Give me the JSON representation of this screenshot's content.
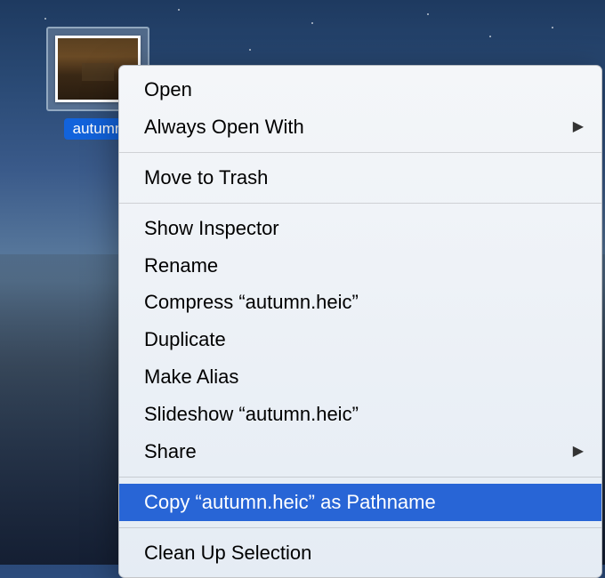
{
  "file": {
    "label": "autumn"
  },
  "menu": {
    "items": [
      {
        "label": "Open",
        "hasSubmenu": false,
        "highlighted": false
      },
      {
        "label": "Always Open With",
        "hasSubmenu": true,
        "highlighted": false
      },
      {
        "type": "separator"
      },
      {
        "label": "Move to Trash",
        "hasSubmenu": false,
        "highlighted": false
      },
      {
        "type": "separator"
      },
      {
        "label": "Show Inspector",
        "hasSubmenu": false,
        "highlighted": false
      },
      {
        "label": "Rename",
        "hasSubmenu": false,
        "highlighted": false
      },
      {
        "label": "Compress “autumn.heic”",
        "hasSubmenu": false,
        "highlighted": false
      },
      {
        "label": "Duplicate",
        "hasSubmenu": false,
        "highlighted": false
      },
      {
        "label": "Make Alias",
        "hasSubmenu": false,
        "highlighted": false
      },
      {
        "label": "Slideshow “autumn.heic”",
        "hasSubmenu": false,
        "highlighted": false
      },
      {
        "label": "Share",
        "hasSubmenu": true,
        "highlighted": false
      },
      {
        "type": "separator"
      },
      {
        "label": "Copy “autumn.heic” as Pathname",
        "hasSubmenu": false,
        "highlighted": true
      },
      {
        "type": "separator"
      },
      {
        "label": "Clean Up Selection",
        "hasSubmenu": false,
        "highlighted": false
      }
    ]
  }
}
